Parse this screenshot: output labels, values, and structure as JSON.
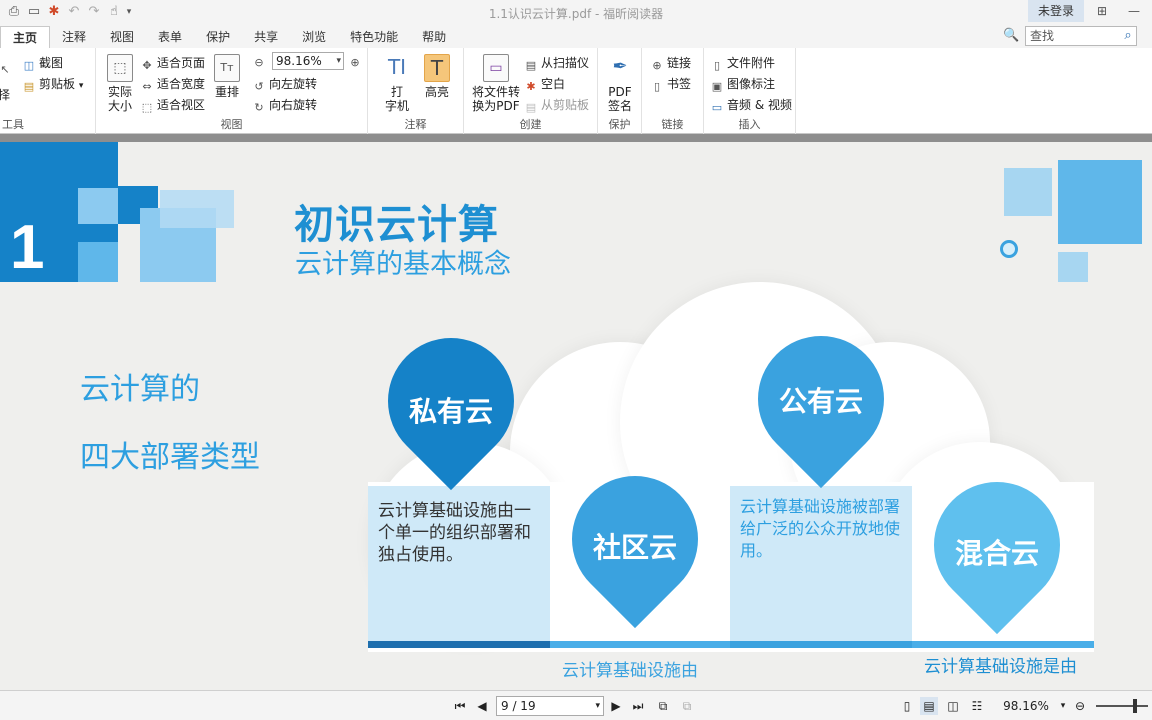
{
  "app": {
    "window_title": "1.1认识云计算.pdf - 福昕阅读器",
    "login_label": "未登录"
  },
  "menu": {
    "tabs": [
      "主页",
      "注释",
      "视图",
      "表单",
      "保护",
      "共享",
      "浏览",
      "特色功能",
      "帮助"
    ],
    "active_tab": "主页",
    "search_placeholder": "查找"
  },
  "ribbon": {
    "tools_group": {
      "label": "工具",
      "select_label": "择"
    },
    "clip": {
      "screenshot": "截图",
      "clipboard": "剪贴板"
    },
    "view_group": {
      "label": "视图",
      "actual_size": [
        "实际",
        "大小"
      ],
      "fit_page": "适合页面",
      "fit_width": "适合宽度",
      "fit_visible": "适合视区",
      "reflow": "重排",
      "zoom_value": "98.16%",
      "rotate_left": "向左旋转",
      "rotate_right": "向右旋转"
    },
    "annot_group": {
      "label": "注释",
      "typewriter": [
        "打",
        "字机"
      ],
      "highlight": "高亮"
    },
    "create_group": {
      "label": "创建",
      "convert": [
        "将文件转",
        "换为PDF"
      ],
      "from_scanner": "从扫描仪",
      "blank": "空白",
      "from_clipboard": "从剪贴板"
    },
    "protect_group": {
      "label": "保护",
      "pdf_sign": [
        "PDF",
        "签名"
      ]
    },
    "link_group": {
      "label": "链接",
      "link": "链接",
      "bookmark": "书签"
    },
    "insert_group": {
      "label": "插入",
      "attachment": "文件附件",
      "image_annot": "图像标注",
      "audio_video": "音频 & 视频"
    }
  },
  "slide": {
    "number": "1",
    "title": "初识云计算",
    "subtitle": "云计算的基本概念",
    "side_title_line1": "云计算的",
    "side_title_line2": "四大部署类型",
    "private_cloud": {
      "label": "私有云",
      "desc": "云计算基础设施由一个单一的组织部署和独占使用。"
    },
    "community_cloud": {
      "label": "社区云",
      "desc": "云计算基础设施由"
    },
    "public_cloud": {
      "label": "公有云",
      "desc": "云计算基础设施被部署给广泛的公众开放地使用。"
    },
    "hybrid_cloud": {
      "label": "混合云",
      "desc": "云计算基础设施是由"
    },
    "colors": {
      "primary": "#1e8fd2",
      "light": "#5fb7ea",
      "pale": "#cfe9f8"
    }
  },
  "statusbar": {
    "page_indicator": "9 / 19",
    "zoom": "98.16%"
  }
}
